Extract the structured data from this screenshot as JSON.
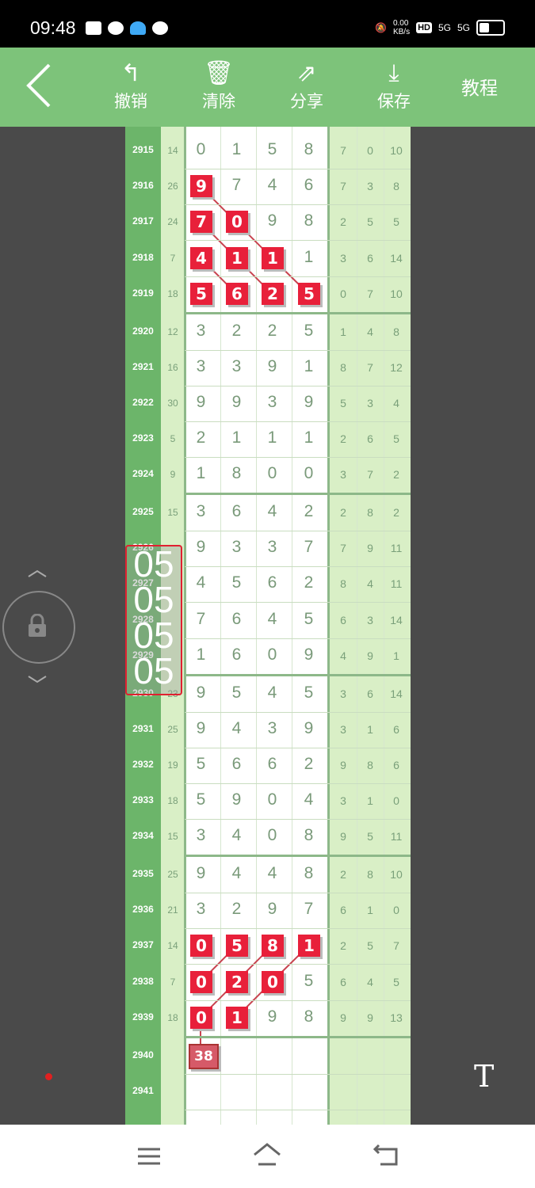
{
  "status": {
    "time": "09:48",
    "net_speed": "0.00",
    "net_unit": "KB/s",
    "sig1": "5G",
    "sig2": "5G"
  },
  "toolbar": {
    "undo": "撤销",
    "clear": "清除",
    "share": "分享",
    "save": "保存",
    "tutorial": "教程"
  },
  "rows": [
    {
      "n": "2915",
      "s": "14",
      "d": [
        "0",
        "1",
        "5",
        "8"
      ],
      "r": [
        "7",
        "0",
        "10"
      ]
    },
    {
      "n": "2916",
      "s": "26",
      "d": [
        "9",
        "7",
        "4",
        "6"
      ],
      "r": [
        "7",
        "3",
        "8"
      ]
    },
    {
      "n": "2917",
      "s": "24",
      "d": [
        "7",
        "0",
        "9",
        "8"
      ],
      "r": [
        "2",
        "5",
        "5"
      ]
    },
    {
      "n": "2918",
      "s": "7",
      "d": [
        "4",
        "1",
        "1",
        "1"
      ],
      "r": [
        "3",
        "6",
        "14"
      ]
    },
    {
      "n": "2919",
      "s": "18",
      "d": [
        "5",
        "6",
        "2",
        "5"
      ],
      "r": [
        "0",
        "7",
        "10"
      ]
    },
    {
      "n": "2920",
      "s": "12",
      "d": [
        "3",
        "2",
        "2",
        "5"
      ],
      "r": [
        "1",
        "4",
        "8"
      ]
    },
    {
      "n": "2921",
      "s": "16",
      "d": [
        "3",
        "3",
        "9",
        "1"
      ],
      "r": [
        "8",
        "7",
        "12"
      ]
    },
    {
      "n": "2922",
      "s": "30",
      "d": [
        "9",
        "9",
        "3",
        "9"
      ],
      "r": [
        "5",
        "3",
        "4"
      ]
    },
    {
      "n": "2923",
      "s": "5",
      "d": [
        "2",
        "1",
        "1",
        "1"
      ],
      "r": [
        "2",
        "6",
        "5"
      ]
    },
    {
      "n": "2924",
      "s": "9",
      "d": [
        "1",
        "8",
        "0",
        "0"
      ],
      "r": [
        "3",
        "7",
        "2"
      ]
    },
    {
      "n": "2925",
      "s": "15",
      "d": [
        "3",
        "6",
        "4",
        "2"
      ],
      "r": [
        "2",
        "8",
        "2"
      ]
    },
    {
      "n": "2926",
      "s": "",
      "d": [
        "9",
        "3",
        "3",
        "7"
      ],
      "r": [
        "7",
        "9",
        "11"
      ]
    },
    {
      "n": "2927",
      "s": "",
      "d": [
        "4",
        "5",
        "6",
        "2"
      ],
      "r": [
        "8",
        "4",
        "11"
      ]
    },
    {
      "n": "2928",
      "s": "",
      "d": [
        "7",
        "6",
        "4",
        "5"
      ],
      "r": [
        "6",
        "3",
        "14"
      ]
    },
    {
      "n": "2929",
      "s": "",
      "d": [
        "1",
        "6",
        "0",
        "9"
      ],
      "r": [
        "4",
        "9",
        "1"
      ]
    },
    {
      "n": "2930",
      "s": "23",
      "d": [
        "9",
        "5",
        "4",
        "5"
      ],
      "r": [
        "3",
        "6",
        "14"
      ]
    },
    {
      "n": "2931",
      "s": "25",
      "d": [
        "9",
        "4",
        "3",
        "9"
      ],
      "r": [
        "3",
        "1",
        "6"
      ]
    },
    {
      "n": "2932",
      "s": "19",
      "d": [
        "5",
        "6",
        "6",
        "2"
      ],
      "r": [
        "9",
        "8",
        "6"
      ]
    },
    {
      "n": "2933",
      "s": "18",
      "d": [
        "5",
        "9",
        "0",
        "4"
      ],
      "r": [
        "3",
        "1",
        "0"
      ]
    },
    {
      "n": "2934",
      "s": "15",
      "d": [
        "3",
        "4",
        "0",
        "8"
      ],
      "r": [
        "9",
        "5",
        "11"
      ]
    },
    {
      "n": "2935",
      "s": "25",
      "d": [
        "9",
        "4",
        "4",
        "8"
      ],
      "r": [
        "2",
        "8",
        "10"
      ]
    },
    {
      "n": "2936",
      "s": "21",
      "d": [
        "3",
        "2",
        "9",
        "7"
      ],
      "r": [
        "6",
        "1",
        "0"
      ]
    },
    {
      "n": "2937",
      "s": "14",
      "d": [
        "0",
        "5",
        "8",
        "1"
      ],
      "r": [
        "2",
        "5",
        "7"
      ]
    },
    {
      "n": "2938",
      "s": "7",
      "d": [
        "0",
        "2",
        "0",
        "5"
      ],
      "r": [
        "6",
        "4",
        "5"
      ]
    },
    {
      "n": "2939",
      "s": "18",
      "d": [
        "0",
        "1",
        "9",
        "8"
      ],
      "r": [
        "9",
        "9",
        "13"
      ]
    },
    {
      "n": "2940",
      "s": "",
      "d": [
        "",
        "",
        "",
        ""
      ],
      "r": [
        "",
        "",
        ""
      ]
    },
    {
      "n": "2941",
      "s": "",
      "d": [
        "",
        "",
        "",
        ""
      ],
      "r": [
        "",
        "",
        ""
      ]
    }
  ],
  "highlights": [
    {
      "row": 1,
      "col": 0,
      "v": "9"
    },
    {
      "row": 2,
      "col": 0,
      "v": "7"
    },
    {
      "row": 2,
      "col": 1,
      "v": "0"
    },
    {
      "row": 3,
      "col": 0,
      "v": "4"
    },
    {
      "row": 3,
      "col": 1,
      "v": "1"
    },
    {
      "row": 3,
      "col": 2,
      "v": "1"
    },
    {
      "row": 4,
      "col": 0,
      "v": "5"
    },
    {
      "row": 4,
      "col": 1,
      "v": "6"
    },
    {
      "row": 4,
      "col": 2,
      "v": "2"
    },
    {
      "row": 4,
      "col": 3,
      "v": "5"
    },
    {
      "row": 22,
      "col": 0,
      "v": "0"
    },
    {
      "row": 22,
      "col": 1,
      "v": "5"
    },
    {
      "row": 22,
      "col": 2,
      "v": "8"
    },
    {
      "row": 22,
      "col": 3,
      "v": "1"
    },
    {
      "row": 23,
      "col": 0,
      "v": "0"
    },
    {
      "row": 23,
      "col": 1,
      "v": "2"
    },
    {
      "row": 23,
      "col": 2,
      "v": "0"
    },
    {
      "row": 24,
      "col": 0,
      "v": "0"
    },
    {
      "row": 24,
      "col": 1,
      "v": "1"
    }
  ],
  "badge_2940": "38",
  "overlay_label": [
    "05",
    "05",
    "05",
    "05"
  ],
  "floating_t": "T"
}
